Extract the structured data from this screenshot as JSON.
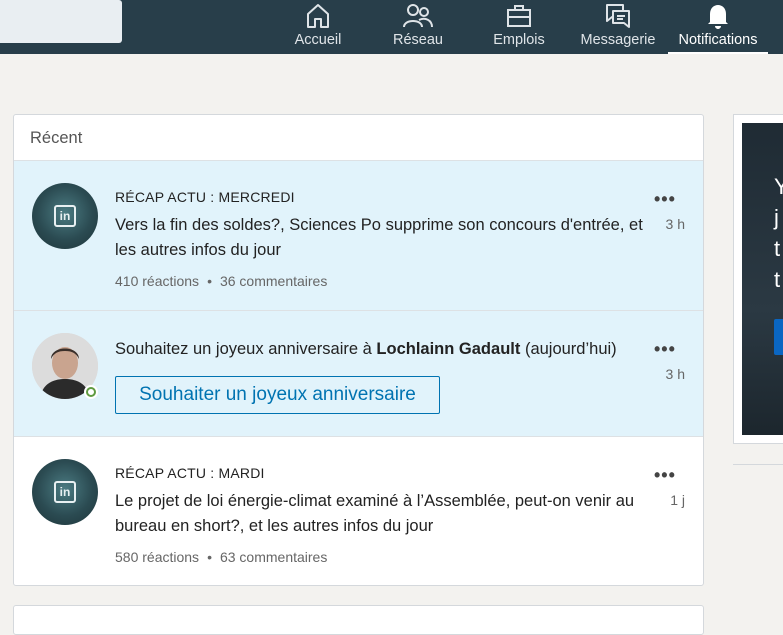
{
  "nav": {
    "items": [
      {
        "label": "Accueil",
        "icon": "home-icon"
      },
      {
        "label": "Réseau",
        "icon": "network-icon"
      },
      {
        "label": "Emplois",
        "icon": "briefcase-icon"
      },
      {
        "label": "Messagerie",
        "icon": "messaging-icon"
      },
      {
        "label": "Notifications",
        "icon": "bell-icon",
        "active": true
      }
    ]
  },
  "card": {
    "header": "Récent",
    "notifications": [
      {
        "label": "RÉCAP ACTU : MERCREDI",
        "headline": "Vers la fin des soldes?, Sciences Po supprime son concours d'entrée, et les autres infos du jour",
        "reactions": "410 réactions",
        "separator": "•",
        "comments": "36 commentaires",
        "time": "3 h",
        "more": "•••"
      },
      {
        "text_before": "Souhaitez un joyeux anniversaire à ",
        "name": "Lochlainn Gadault",
        "text_after": " (aujourd’hui)",
        "button": "Souhaiter un joyeux anniversaire",
        "time": "3 h",
        "more": "•••"
      },
      {
        "label": "RÉCAP ACTU : MARDI",
        "headline": "Le projet de loi énergie-climat examiné à l’Assemblée, peut-on venir au bureau en short?, et les autres infos du jour",
        "reactions": "580 réactions",
        "separator": "•",
        "comments": "63 commentaires",
        "time": "1 j",
        "more": "•••"
      }
    ]
  },
  "ad": {
    "letters": [
      "Y",
      "j",
      "t",
      "t"
    ]
  },
  "colors": {
    "topbar": "#283e4a",
    "unread_bg": "#e1f3fb",
    "accent": "#0073b1",
    "online": "#5f9b41"
  }
}
